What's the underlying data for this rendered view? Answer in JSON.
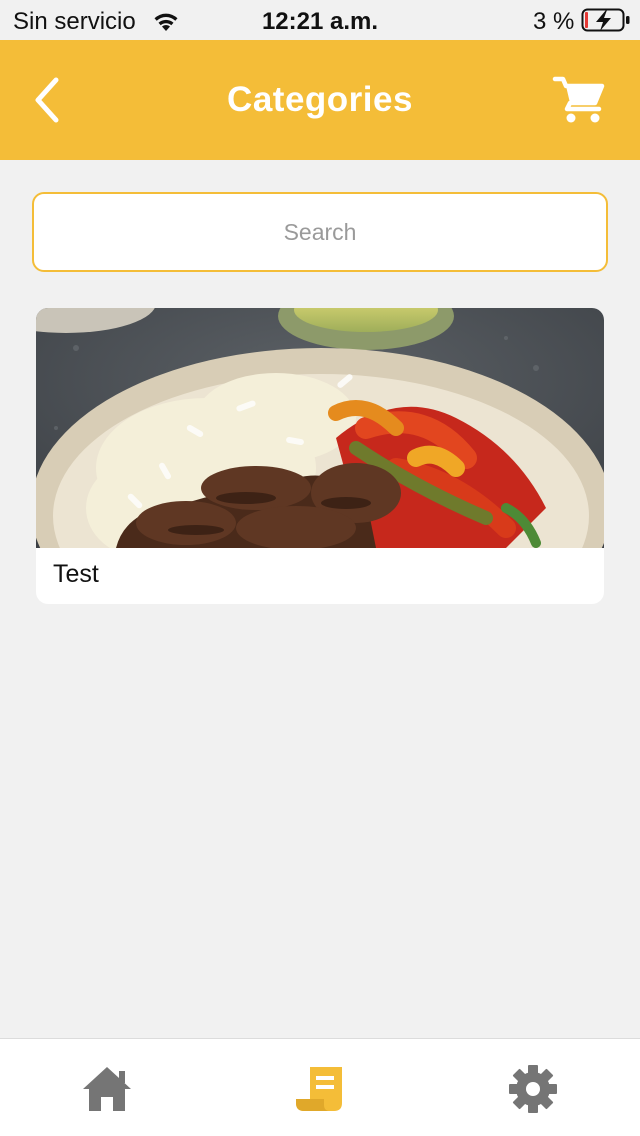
{
  "status_bar": {
    "carrier": "Sin servicio",
    "time": "12:21 a.m.",
    "battery_percent": "3 %"
  },
  "header": {
    "title": "Categories",
    "back_icon": "chevron-left-icon",
    "cart_icon": "cart-icon"
  },
  "search": {
    "placeholder": "Search",
    "value": ""
  },
  "categories": [
    {
      "label": "Test",
      "image": "food-bowl-photo"
    }
  ],
  "tab_bar": {
    "tabs": [
      {
        "icon": "home-icon",
        "active": false
      },
      {
        "icon": "receipt-icon",
        "active": true
      },
      {
        "icon": "gear-icon",
        "active": false
      }
    ]
  },
  "colors": {
    "accent": "#f4bd38",
    "background": "#f1f1f1",
    "inactive_icon": "#757575"
  }
}
